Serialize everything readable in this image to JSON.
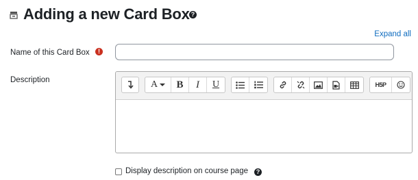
{
  "page": {
    "title": "Adding a new Card Box",
    "title_help_glyph": "?",
    "expand_all": "Expand all"
  },
  "form": {
    "name_label": "Name of this Card Box",
    "required_glyph": "!",
    "name_value": "",
    "description_label": "Description",
    "display_description_label": "Display description on course page",
    "help_glyph": "?"
  },
  "toolbar": {
    "groups": [
      [
        "show-more-buttons"
      ],
      [
        "font-color",
        "bold",
        "italic",
        "underline"
      ],
      [
        "unordered-list",
        "ordered-list"
      ],
      [
        "link",
        "unlink",
        "image",
        "media",
        "table"
      ],
      [
        "h5p",
        "emoji"
      ]
    ],
    "bold_glyph": "B",
    "italic_glyph": "I",
    "underline_glyph": "U",
    "font_glyph": "A",
    "h5p_glyph": "H5P"
  }
}
